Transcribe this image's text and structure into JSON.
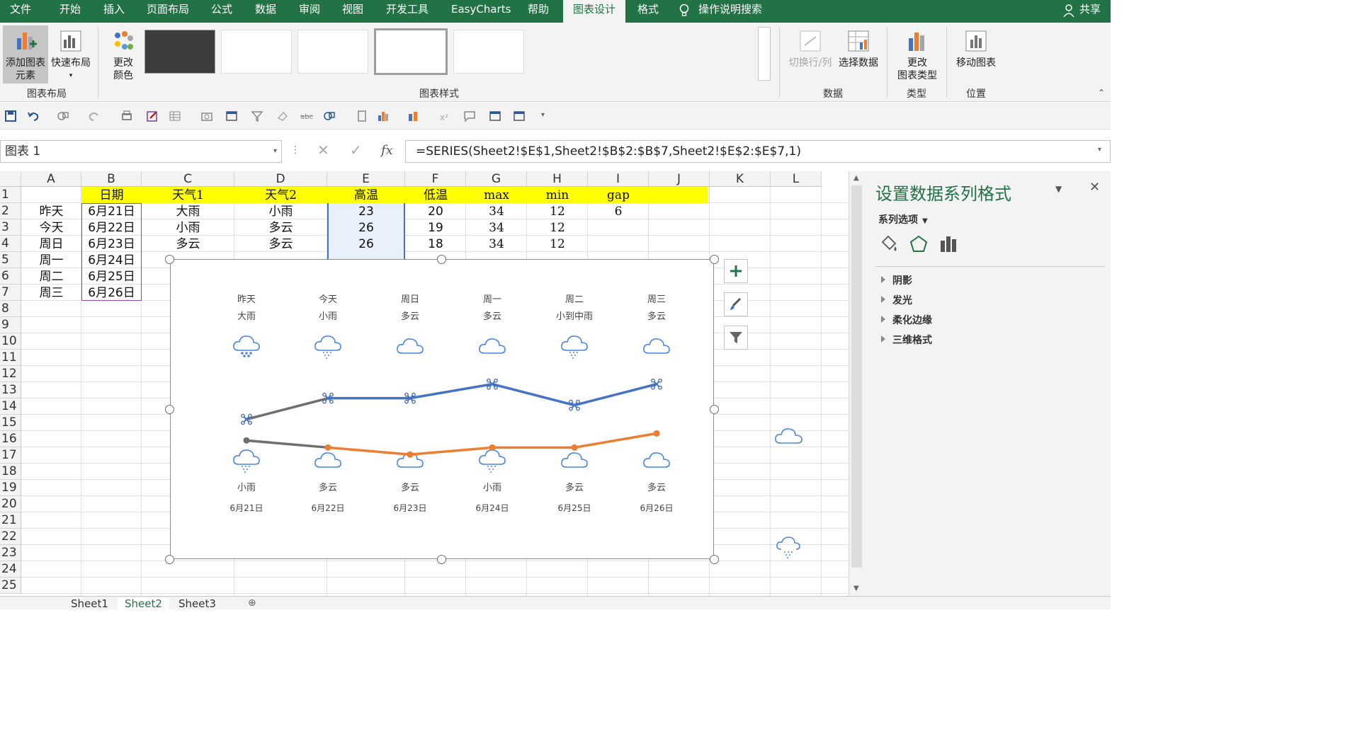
{
  "menu": {
    "tabs": [
      "文件",
      "开始",
      "插入",
      "页面布局",
      "公式",
      "数据",
      "审阅",
      "视图",
      "开发工具",
      "EasyCharts",
      "帮助",
      "图表设计",
      "格式"
    ],
    "active_tab": "图表设计",
    "search": "操作说明搜索",
    "share": "共享"
  },
  "ribbon": {
    "add_element_l1": "添加图表",
    "add_element_l2": "元素",
    "quick_layout": "快速布局",
    "change_colors_l1": "更改",
    "change_colors_l2": "颜色",
    "switch_row_col": "切换行/列",
    "select_data": "选择数据",
    "change_type_l1": "更改",
    "change_type_l2": "图表类型",
    "move_chart": "移动图表",
    "groups": {
      "layout": "图表布局",
      "styles": "图表样式",
      "data": "数据",
      "type": "类型",
      "location": "位置"
    }
  },
  "formula_bar": {
    "name_box": "图表 1",
    "fx": "fx",
    "formula": "=SERIES(Sheet2!$E$1,Sheet2!$B$2:$B$7,Sheet2!$E$2:$E$7,1)"
  },
  "sheet": {
    "columns": [
      "A",
      "B",
      "C",
      "D",
      "E",
      "F",
      "G",
      "H",
      "I",
      "J",
      "K",
      "L"
    ],
    "rows": [
      "1",
      "2",
      "3",
      "4",
      "5",
      "6",
      "7",
      "8",
      "9",
      "10",
      "11",
      "12",
      "13",
      "14",
      "15",
      "16",
      "17",
      "18",
      "19",
      "20",
      "21",
      "22",
      "23",
      "24",
      "25"
    ],
    "headers": {
      "b": "日期",
      "c": "天气1",
      "d": "天气2",
      "e": "高温",
      "f": "低温",
      "g": "max",
      "h": "min",
      "i": "gap"
    },
    "data_rows": [
      {
        "a": "昨天",
        "b": "6月21日",
        "c": "大雨",
        "d": "小雨",
        "e": "23",
        "f": "20",
        "g": "34",
        "h": "12",
        "i": "6"
      },
      {
        "a": "今天",
        "b": "6月22日",
        "c": "小雨",
        "d": "多云",
        "e": "26",
        "f": "19",
        "g": "34",
        "h": "12",
        "i": ""
      },
      {
        "a": "周日",
        "b": "6月23日",
        "c": "多云",
        "d": "多云",
        "e": "26",
        "f": "18",
        "g": "34",
        "h": "12",
        "i": ""
      },
      {
        "a": "周一",
        "b": "6月24日",
        "c": "",
        "d": "",
        "e": "",
        "f": "",
        "g": "",
        "h": "",
        "i": ""
      },
      {
        "a": "周二",
        "b": "6月25日",
        "c": "",
        "d": "",
        "e": "",
        "f": "",
        "g": "",
        "h": "",
        "i": ""
      },
      {
        "a": "周三",
        "b": "6月26日",
        "c": "",
        "d": "",
        "e": "",
        "f": "",
        "g": "",
        "h": "",
        "i": ""
      }
    ]
  },
  "chart_data": {
    "type": "line",
    "categories": [
      "6月21日",
      "6月22日",
      "6月23日",
      "6月24日",
      "6月25日",
      "6月26日"
    ],
    "top_days": [
      "昨天",
      "今天",
      "周日",
      "周一",
      "周二",
      "周三"
    ],
    "top_weather": [
      "大雨",
      "小雨",
      "多云",
      "多云",
      "小到中雨",
      "多云"
    ],
    "bottom_weather": [
      "小雨",
      "多云",
      "多云",
      "小雨",
      "多云",
      "多云"
    ],
    "series": [
      {
        "values": [
          23,
          26,
          26,
          28,
          25,
          28
        ],
        "color": "#4472c4"
      },
      {
        "values": [
          20,
          19,
          18,
          19,
          19,
          21
        ],
        "color": "#ed7d31"
      }
    ],
    "ylim": [
      12,
      34
    ],
    "line_colors": {
      "high": "#4472c4",
      "low": "#ed7d31",
      "first_segment": "#6f6f6f"
    },
    "icon_color": "#4a86e8"
  },
  "panel": {
    "title": "设置数据系列格式",
    "section": "系列选项",
    "items": [
      "阴影",
      "发光",
      "柔化边缘",
      "三维格式"
    ]
  },
  "sheet_tabs": [
    "Sheet1",
    "Sheet2",
    "Sheet3"
  ],
  "active_sheet": "Sheet2",
  "colors": {
    "excel_green": "#217346",
    "yellow_header": "#ffff00",
    "selection_fill": "#e8f0fb"
  }
}
